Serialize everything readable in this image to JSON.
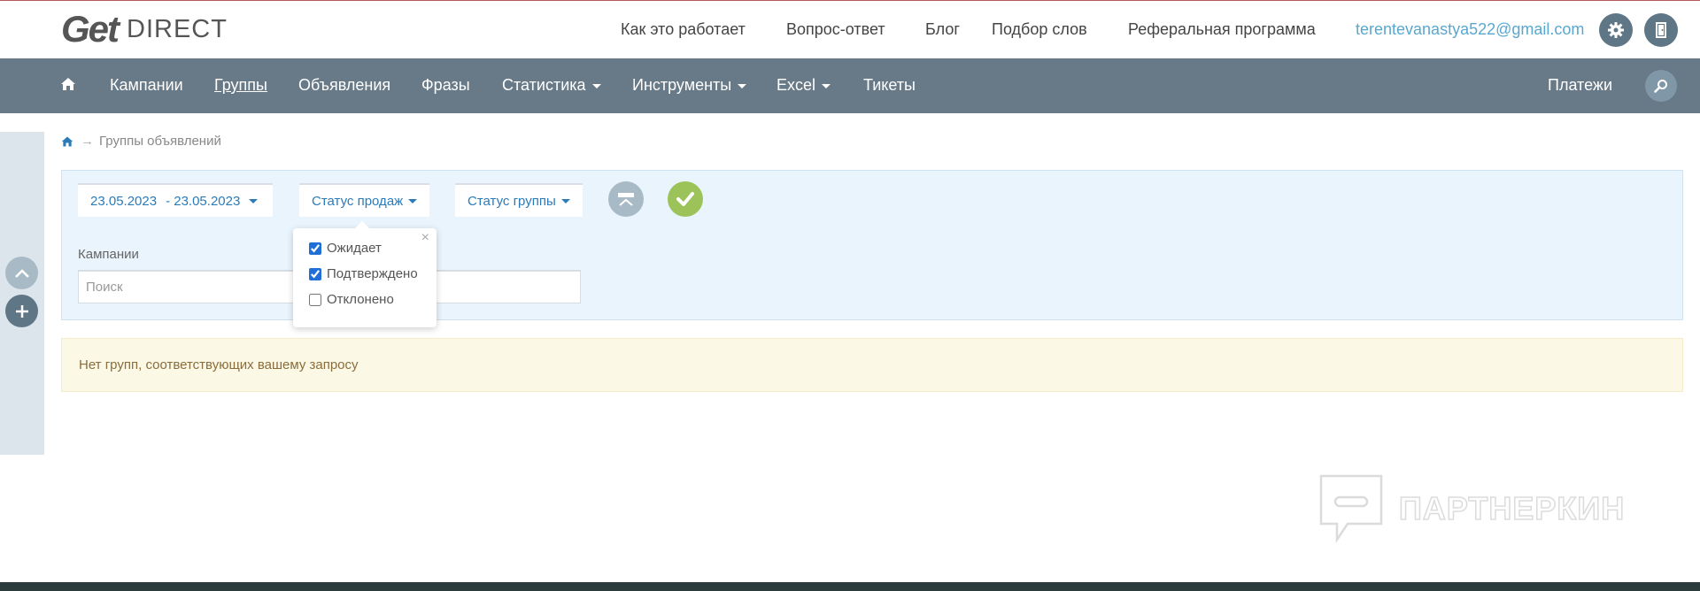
{
  "header": {
    "logo_get": "Get",
    "logo_direct": "DIRECT",
    "links": [
      "Как это работает",
      "Вопрос-ответ",
      "Блог",
      "Подбор слов",
      "Реферальная программа"
    ],
    "email": "terentevanastya522@gmail.com",
    "settings_icon": "gear-icon",
    "logout_icon": "door-exit-icon"
  },
  "nav": {
    "home_icon": "home-icon",
    "items": [
      "Кампании",
      "Группы",
      "Объявления",
      "Фразы",
      "Статистика",
      "Инструменты",
      "Excel",
      "Тикеты"
    ],
    "active": "Группы",
    "payments": "Платежи",
    "search_icon": "search-icon"
  },
  "breadcrumb": {
    "home_icon": "home-icon",
    "current": "Группы объявлений"
  },
  "filters": {
    "date_from": "23.05.2023",
    "date_to": "- 23.05.2023",
    "sales_status": "Статус продаж",
    "group_status": "Статус группы",
    "campaigns_label": "Кампании",
    "search_placeholder": "Поиск"
  },
  "popover": {
    "close": "×",
    "options": [
      {
        "label": "Ожидает",
        "checked": true
      },
      {
        "label": "Подтверждено",
        "checked": true
      },
      {
        "label": "Отклонено",
        "checked": false
      }
    ]
  },
  "alert": {
    "message": "Нет групп, соответствующих вашему запросу"
  },
  "watermark": {
    "text": "ПАРТНЕРКИН"
  },
  "colors": {
    "navbar": "#687987",
    "link_blue": "#2b7bb9",
    "email_blue": "#5aa7cf",
    "confirm_green": "#9bc35a",
    "alert_bg": "#fcf8e6"
  }
}
